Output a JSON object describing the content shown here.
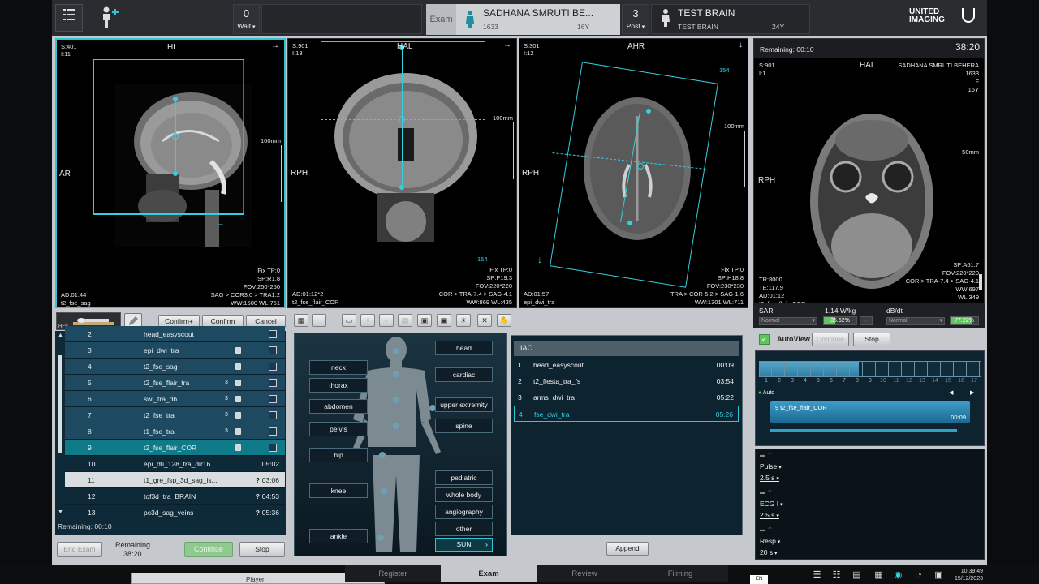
{
  "topbar": {
    "wait_count": "0",
    "wait_label": "Wait",
    "exam_label": "Exam",
    "patient_name": "SADHANA SMRUTI BE...",
    "patient_id": "1633",
    "patient_age": "16Y",
    "post_count": "3",
    "post_label": "Post",
    "protocol_name": "TEST BRAIN",
    "protocol_sub": "TEST BRAIN",
    "protocol_age": "24Y",
    "brand_line1": "UNITED",
    "brand_line2": "IMAGING"
  },
  "viewports": [
    {
      "tl1": "S:401",
      "tl2": "I:11",
      "top_label": "HL",
      "arrow": "→",
      "left_label": "AR",
      "scale": "100mm",
      "br": [
        "Fix TP:0",
        "SP:R1.8",
        "FOV:250*250",
        "SAG > COR3.0 > TRA1.2",
        "WW:1500 WL:751"
      ],
      "bl": [
        "AD:01:44",
        "t2_fse_sag"
      ]
    },
    {
      "tl1": "S:901",
      "tl2": "I:13",
      "top_label": "HAL",
      "arrow": "→",
      "left_label": "RPH",
      "scale": "100mm",
      "corner": "154",
      "br": [
        "Fix TP:0",
        "SP:P19.3",
        "FOV:220*220",
        "COR > TRA-7.4 > SAG-4.1",
        "WW:869 WL:435"
      ],
      "bl": [
        "AD:01:12*2",
        "t2_fse_flair_COR"
      ]
    },
    {
      "tl1": "S:301",
      "tl2": "I:12",
      "top_label": "AHR",
      "arrow": "↓",
      "left_label": "RPH",
      "scale": "100mm",
      "corner": "154",
      "br": [
        "Fix TP:0",
        "SP:H18.8",
        "FOV:230*230",
        "TRA > COR-5.2 > SAG-1.6",
        "WW:1301 WL:711"
      ],
      "bl": [
        "AD:01:57",
        "epi_dwi_tra"
      ]
    }
  ],
  "preview": {
    "remaining": "Remaining: 00:10",
    "clock": "38:20",
    "tl1": "S:901",
    "tl2": "I:1",
    "top_label": "HAL",
    "patient": "SADHANA SMRUTI BEHERA",
    "pid": "1633",
    "sex": "F",
    "age": "16Y",
    "left_label": "RPH",
    "scale": "50mm",
    "br": [
      "SP:A61.7",
      "FOV:220*220",
      "COR > TRA-7.4 > SAG-4.1",
      "WW:697",
      "WL:349"
    ],
    "bl": [
      "TR:8000",
      "TE:117.9",
      "AD:01:12",
      "t2_fse_flair_COR"
    ]
  },
  "sar": {
    "label": "SAR",
    "value": "1.14 W/kg",
    "mode": "Normal",
    "pct": "35.62%",
    "pct_fill": 0.3562,
    "dbdt_label": "dB/dt",
    "dbdt_mode": "Normal",
    "dbdt_pct": "77.22%",
    "dbdt_fill": 0.7722
  },
  "autoview": {
    "label": "AutoView",
    "continue": "Continue",
    "stop": "Stop"
  },
  "left_toolbar": {
    "pose": "HFS",
    "confirm_plus": "Confirm+",
    "confirm": "Confirm",
    "cancel": "Cancel"
  },
  "protocol_list": [
    {
      "n": "2",
      "name": "head_easyscout",
      "time": "",
      "lock": false,
      "x": "",
      "q": false,
      "state": "done"
    },
    {
      "n": "3",
      "name": "epi_dwi_tra",
      "time": "",
      "lock": true,
      "x": "",
      "q": false,
      "state": "done"
    },
    {
      "n": "4",
      "name": "t2_fse_sag",
      "time": "",
      "lock": true,
      "x": "",
      "q": false,
      "state": "done"
    },
    {
      "n": "5",
      "name": "t2_fse_flair_tra",
      "time": "",
      "lock": true,
      "x": "3",
      "q": false,
      "state": "done"
    },
    {
      "n": "6",
      "name": "swi_tra_db",
      "time": "",
      "lock": true,
      "x": "3",
      "q": false,
      "state": "done"
    },
    {
      "n": "7",
      "name": "t2_fse_tra",
      "time": "",
      "lock": true,
      "x": "3",
      "q": false,
      "state": "done"
    },
    {
      "n": "8",
      "name": "t1_fse_tra",
      "time": "",
      "lock": true,
      "x": "3",
      "q": false,
      "state": "done"
    },
    {
      "n": "9",
      "name": "t2_fse_flair_COR",
      "time": "",
      "lock": true,
      "x": "",
      "q": false,
      "state": "active"
    },
    {
      "n": "10",
      "name": "epi_dti_128_tra_dir16",
      "time": "05:02",
      "lock": false,
      "x": "",
      "q": false,
      "state": "pending"
    },
    {
      "n": "11",
      "name": "t1_gre_fsp_3d_sag_is...",
      "time": "03:06",
      "lock": false,
      "x": "",
      "q": true,
      "state": "selected"
    },
    {
      "n": "12",
      "name": "tof3d_tra_BRAIN",
      "time": "04:53",
      "lock": false,
      "x": "",
      "q": true,
      "state": "pending"
    },
    {
      "n": "13",
      "name": "pc3d_sag_veins",
      "time": "05:36",
      "lock": false,
      "x": "",
      "q": true,
      "state": "pending"
    }
  ],
  "list_footer": {
    "remaining": "Remaining: 00:10",
    "end_exam": "End Exam",
    "remaining_label": "Remaining",
    "remaining_time": "38:20",
    "continue": "Continue",
    "stop": "Stop"
  },
  "body_labels": {
    "left": [
      "neck",
      "thorax",
      "abdomen",
      "pelvis",
      "hip",
      "knee",
      "ankle"
    ],
    "right_top": [
      "head",
      "cardiac",
      "upper extremity",
      "spine"
    ],
    "right_bottom": [
      "pediatric",
      "whole body",
      "angiography",
      "other"
    ],
    "sun": "SUN"
  },
  "iac": {
    "title": "IAC",
    "rows": [
      {
        "n": "1",
        "name": "head_easyscout",
        "time": "00:09"
      },
      {
        "n": "2",
        "name": "t2_fiesta_tra_fs",
        "time": "03:54"
      },
      {
        "n": "3",
        "name": "arms_dwi_tra",
        "time": "05:22"
      },
      {
        "n": "4",
        "name": "fse_dwi_tra",
        "time": "05:26"
      }
    ],
    "append": "Append"
  },
  "timeline": {
    "numbers": [
      "1",
      "2",
      "3",
      "4",
      "5",
      "6",
      "7",
      "8",
      "9",
      "10",
      "11",
      "12",
      "13",
      "14",
      "15",
      "16",
      "17"
    ],
    "progress": 0.82,
    "auto": "Auto",
    "job_name": "9   t2_fse_flair_COR",
    "job_time": "00:09"
  },
  "monitor": [
    {
      "label": "Pulse",
      "value": "2.5 s"
    },
    {
      "label": "ECG I",
      "value": "2.5 s"
    },
    {
      "label": "Resp",
      "value": "20 s"
    }
  ],
  "bottom_tabs": [
    "Register",
    "Exam",
    "Review",
    "Filming"
  ],
  "player": {
    "label": "Player",
    "close": "×"
  },
  "tray": {
    "lang": "EN",
    "time": "10:39:49",
    "date": "15/12/2023"
  },
  "colors": {
    "accent": "#35d0e0",
    "list_bg": "#123a4d",
    "active_row": "#0f6f80",
    "green": "#5fc65f"
  }
}
